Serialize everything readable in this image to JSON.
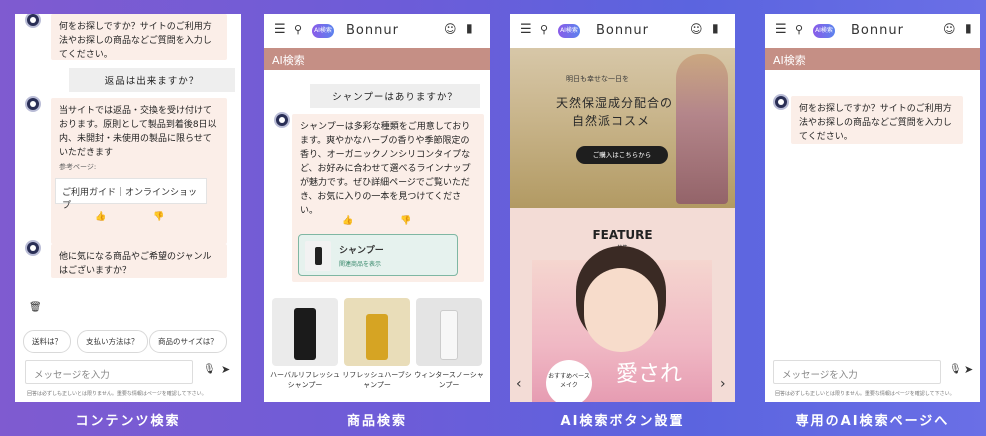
{
  "panel1": {
    "bot_msg_1": "何をお探しですか？サイトのご利用方法やお探しの商品などご質問を入力してください。",
    "user_msg": "返品は出来ますか？",
    "bot_msg_2": "当サイトでは返品・交換を受け付けております。原則として製品到着後8日以内、未開封・未使用の製品に限らせていただきます",
    "ref_label": "参考ページ:",
    "ref_link": "ご利用ガイド｜オンラインショップ",
    "bot_msg_3": "他に気になる商品やご希望のジャンルはございますか？",
    "chips": [
      "送料は？",
      "支払い方法は？",
      "商品のサイズは？"
    ],
    "input_placeholder": "メッセージを入力",
    "disclaimer": "回答は必ずしも正しいとは限りません。重要な情報はページを確認して下さい。",
    "caption": "コンテンツ検索"
  },
  "panel2": {
    "brand": "Bonnur",
    "ai_pill": "AI検索",
    "band_title": "AI検索",
    "user_msg": "シャンプーはありますか？",
    "bot_msg": "シャンプーは多彩な種類をご用意しております。爽やかなハーブの香りや季節限定の香り、オーガニックノンシリコンタイプなど、お好みに合わせて選べるラインナップが魅力です。ぜひ詳細ページでご覧いただき、お気に入りの一本を見つけてください。",
    "product_link_title": "シャンプー",
    "product_link_sub": "関連商品を表示",
    "products": [
      {
        "name": "ハーバルリフレッシュシャンプー"
      },
      {
        "name": "リフレッシュハーブシャンプー"
      },
      {
        "name": "ウィンタースノーシャンプー"
      }
    ],
    "caption": "商品検索"
  },
  "panel3": {
    "brand": "Bonnur",
    "ai_pill": "AI検索",
    "hero_small": "明日も幸せな一日を",
    "hero_title_1": "天然保湿成分配合の",
    "hero_title_2": "自然派コスメ",
    "hero_button": "ご購入はこちらから",
    "feature_title": "FEATURE",
    "feature_sub": "特集",
    "promo_text": "愛され",
    "promo_badge": "おすすめベースメイク",
    "caption": "AI検索ボタン設置"
  },
  "panel4": {
    "brand": "Bonnur",
    "ai_pill": "AI検索",
    "band_title": "AI検索",
    "bot_msg": "何をお探しですか？サイトのご利用方法やお探しの商品などご質問を入力してください。",
    "input_placeholder": "メッセージを入力",
    "disclaimer": "回答は必ずしも正しいとは限りません。重要な情報はページを確認して下さい。",
    "caption": "専用のAI検索ページへ"
  },
  "colors": {
    "band": "#c58f85",
    "bubble_bot": "#fbeee8",
    "bubble_user": "#eeeeee",
    "accent": "#7a62de"
  }
}
